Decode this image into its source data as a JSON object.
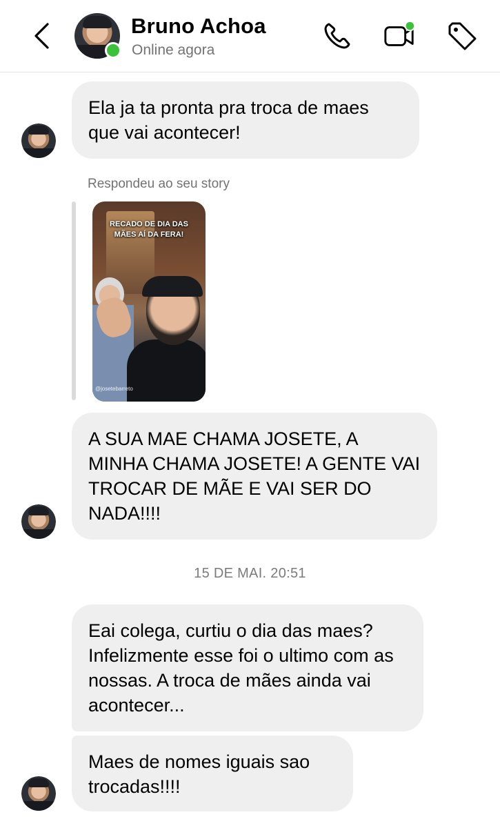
{
  "header": {
    "contact_name": "Bruno Achoa",
    "status": "Online agora",
    "online_color": "#3cc13b",
    "icons": [
      "back-arrow-icon",
      "phone-icon",
      "video-call-icon",
      "tag-icon"
    ]
  },
  "messages": [
    {
      "from": "contact",
      "text": "Ela ja ta pronta pra troca de maes que vai acontecer!"
    },
    {
      "from": "contact",
      "reply_label": "Respondeu ao seu story",
      "story_caption": "RECADO DE DIA DAS MÃES AÍ DA FERA!",
      "story_tag": "@josetebarreto"
    },
    {
      "from": "contact",
      "text": "A SUA MAE CHAMA JOSETE, A MINHA CHAMA JOSETE! A GENTE VAI TROCAR DE MÃE E VAI SER DO NADA!!!!"
    },
    {
      "type": "timestamp",
      "text": "15 DE MAI. 20:51"
    },
    {
      "from": "contact",
      "text": "Eai colega, curtiu o dia das maes? Infelizmente esse foi o ultimo com as nossas. A troca de mães ainda vai acontecer..."
    },
    {
      "from": "contact",
      "text": "Maes de nomes iguais sao trocadas!!!!"
    }
  ]
}
